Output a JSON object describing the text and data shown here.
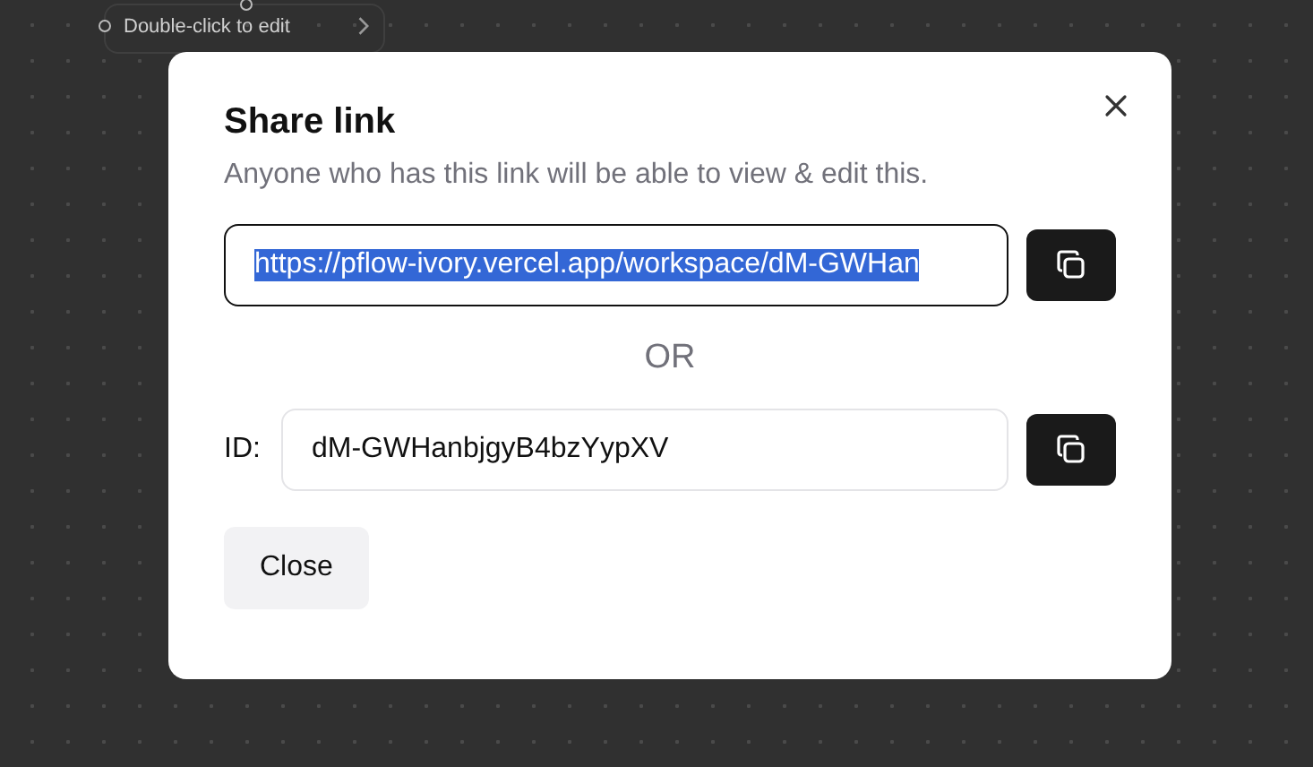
{
  "canvas": {
    "node": {
      "label": "Double-click to edit"
    }
  },
  "dialog": {
    "title": "Share link",
    "description": "Anyone who has this link will be able to view & edit this.",
    "link": {
      "value": "https://pflow-ivory.vercel.app/workspace/dM-GWHan",
      "text_selected": true
    },
    "separator": "OR",
    "id_field": {
      "label": "ID:",
      "value": "dM-GWHanbjgyB4bzYypXV"
    },
    "buttons": [
      {
        "label": "Close"
      }
    ]
  }
}
